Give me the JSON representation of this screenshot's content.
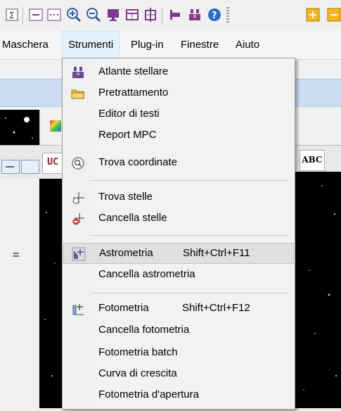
{
  "toolbar": {
    "icons": [
      "equals-sign-icon",
      "minimize-window-icon",
      "dotted-window-icon",
      "zoom-in-icon",
      "zoom-out-icon",
      "monitor-icon",
      "window-layout-icon",
      "tile-windows-icon",
      "align-icon",
      "star-chart-icon",
      "help-icon",
      "add-icon",
      "minus-icon"
    ]
  },
  "menubar": {
    "items": [
      "Maschera",
      "Strumenti",
      "Plug-in",
      "Finestre",
      "Aiuto"
    ]
  },
  "background": {
    "tab_left_label": "UC",
    "tab_right_label": "ABC",
    "equals_label": "="
  },
  "menu": {
    "items": [
      {
        "label": "Atlante stellare",
        "icon": "star-atlas-icon"
      },
      {
        "label": "Pretrattamento",
        "icon": "folder-icon"
      },
      {
        "label": "Editor di testi",
        "icon": ""
      },
      {
        "label": "Report MPC",
        "icon": ""
      },
      {
        "label": "Trova coordinate",
        "icon": "find-coordinates-icon"
      },
      {
        "label": "Trova stelle",
        "icon": "find-stars-icon"
      },
      {
        "label": "Cancella stelle",
        "icon": "delete-stars-icon"
      },
      {
        "label": "Astrometria",
        "shortcut": "Shift+Ctrl+F11",
        "icon": "astrometry-icon",
        "highlighted": true
      },
      {
        "label": "Cancella astrometria",
        "icon": ""
      },
      {
        "label": "Fotometria",
        "shortcut": "Shift+Ctrl+F12",
        "icon": "photometry-icon"
      },
      {
        "label": "Cancella fotometria",
        "icon": ""
      },
      {
        "label": "Fotometria batch",
        "icon": ""
      },
      {
        "label": "Curva di crescita",
        "icon": ""
      },
      {
        "label": "Fotometria d'apertura",
        "icon": ""
      }
    ]
  },
  "colors": {
    "menu_bg": "#f2f2f2",
    "highlight_bg": "#e0e0e0",
    "active_menu_bg": "#e5f1fb",
    "band_blue": "#c9dcf0"
  }
}
